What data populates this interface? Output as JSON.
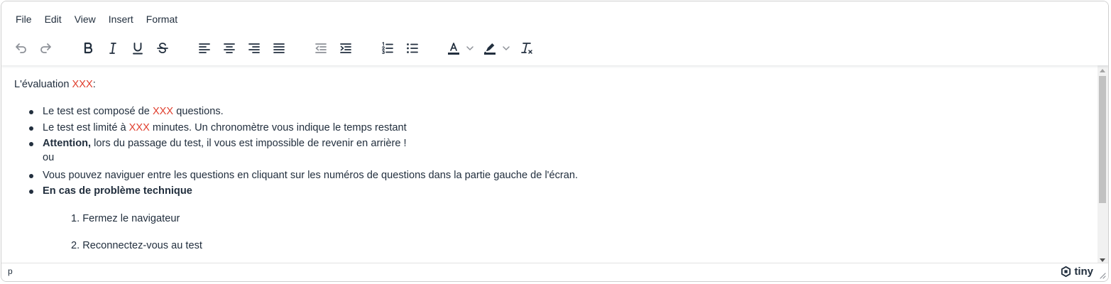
{
  "menubar": {
    "items": [
      "File",
      "Edit",
      "View",
      "Insert",
      "Format"
    ]
  },
  "toolbar": {
    "buttons": [
      "undo-icon",
      "redo-icon",
      "bold-icon",
      "italic-icon",
      "underline-icon",
      "strikethrough-icon",
      "align-left-icon",
      "align-center-icon",
      "align-right-icon",
      "align-justify-icon",
      "outdent-icon",
      "indent-icon",
      "numbered-list-icon",
      "bullet-list-icon",
      "text-color-icon",
      "highlight-color-icon",
      "clear-formatting-icon"
    ],
    "text_color": "#222f3e",
    "highlight_color": "#222f3e"
  },
  "content": {
    "intro_prefix": "L'évaluation ",
    "intro_placeholder": "XXX",
    "intro_suffix": ":",
    "bullet1_prefix": "Le test est composé de ",
    "bullet1_placeholder": "XXX",
    "bullet1_suffix": " questions.",
    "bullet2_prefix": "Le test est limité à ",
    "bullet2_placeholder": "XXX",
    "bullet2_suffix": " minutes. Un chronomètre vous indique le temps restant",
    "bullet3_bold": "Attention,",
    "bullet3_text": " lors du passage du test, il vous est impossible de revenir en arrière !",
    "bullet3_line2": "ou",
    "bullet4": "Vous pouvez naviguer entre les questions en cliquant sur les numéros de questions dans la partie gauche de l'écran.",
    "bullet5_bold": "En cas de problème technique",
    "step1": "1. Fermez le navigateur",
    "step2": "2. Reconnectez-vous au test"
  },
  "statusbar": {
    "path": "p",
    "brand": "tiny"
  },
  "colors": {
    "placeholder_red": "#e03e2d",
    "text": "#222f3e"
  }
}
